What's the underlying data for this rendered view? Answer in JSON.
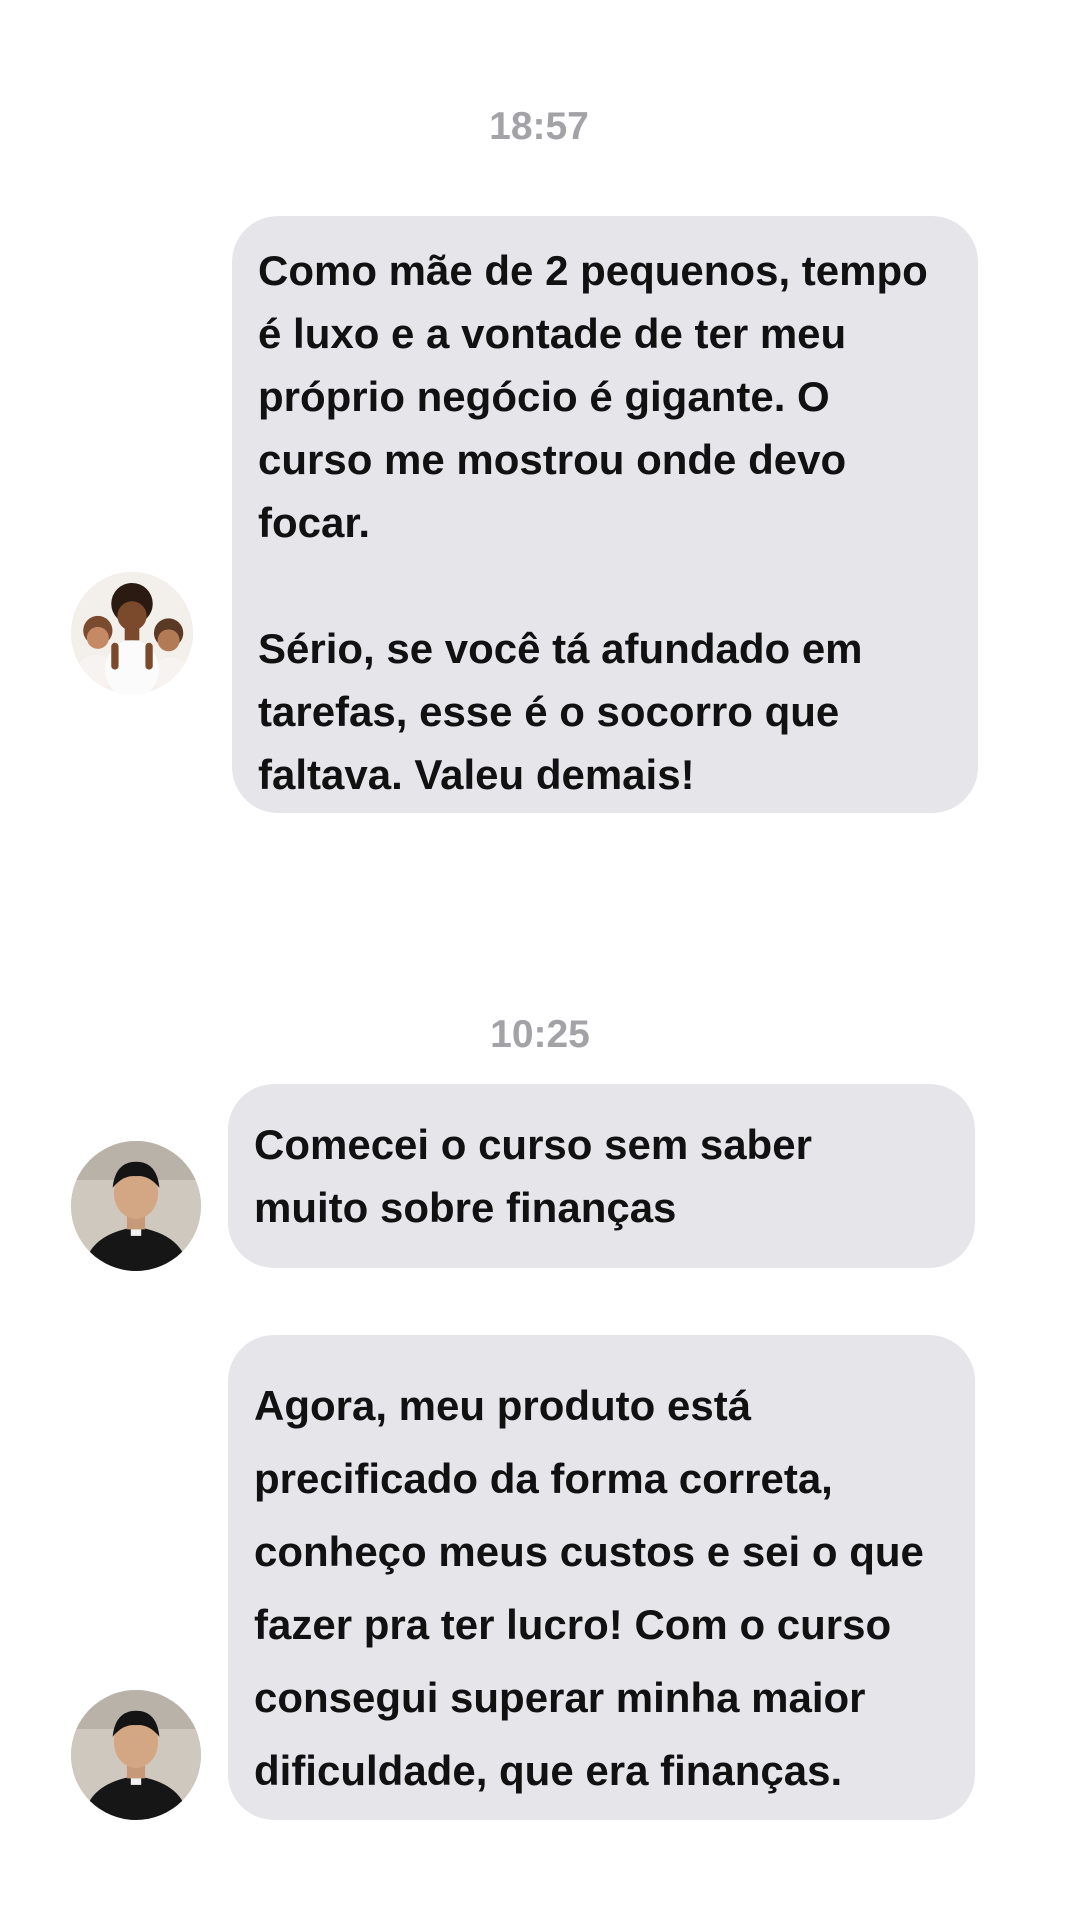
{
  "messages": [
    {
      "time": "18:57",
      "text": "Como mãe de 2 pequenos, tempo\né luxo e a vontade de ter meu\npróprio negócio é gigante. O\ncurso me mostrou onde devo\nfocar.\n\nSério, se você tá afundado em\ntarefas, esse é o socorro que\nfaltava. Valeu demais!"
    },
    {
      "time": "10:25",
      "text": "Comecei o curso sem saber\nmuito sobre finanças"
    },
    {
      "text": "Agora, meu produto está\nprecificado da forma correta,\nconheço meus custos e sei o que\nfazer pra ter lucro! Com o curso\nconsegui superar minha maior\ndificuldade, que era finanças."
    }
  ],
  "colors": {
    "bubble": "#e6e5ea",
    "timestamp": "#a3a3a7",
    "text": "#111111"
  }
}
